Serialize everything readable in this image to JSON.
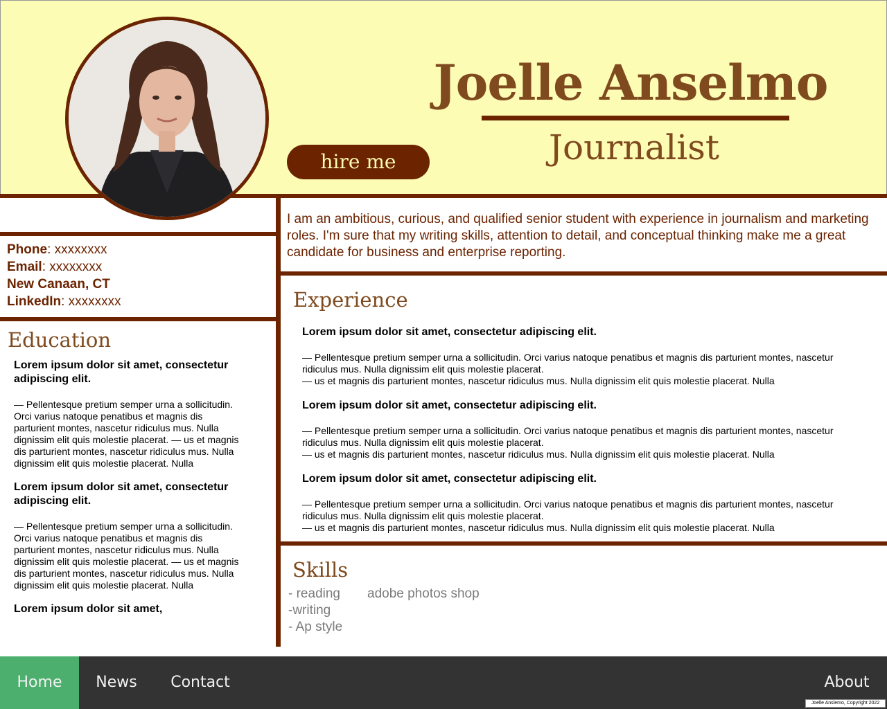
{
  "header": {
    "name": "Joelle Anselmo",
    "role": "Journalist",
    "hire_label": "hire me"
  },
  "contact": {
    "phone_label": "Phone",
    "phone_value": ": xxxxxxxx",
    "email_label": "Email",
    "email_value": ": xxxxxxxx",
    "location": "New Canaan, CT",
    "linkedin_label": "LinkedIn",
    "linkedin_value": ": xxxxxxxx"
  },
  "summary": "I am an ambitious, curious, and qualified senior student with experience in journalism and marketing roles. I'm sure that my writing skills, attention to detail, and conceptual thinking make me a great candidate for business and enterprise reporting.",
  "education": {
    "title": "Education",
    "entries": [
      {
        "title": "Lorem ipsum dolor sit amet, consectetur adipiscing elit.",
        "body": "— Pellentesque pretium semper urna a sollicitudin. Orci varius natoque penatibus et magnis dis parturient montes, nascetur ridiculus mus. Nulla dignissim elit quis molestie placerat. — us et magnis dis parturient montes, nascetur ridiculus mus. Nulla dignissim elit quis molestie placerat. Nulla"
      },
      {
        "title": "Lorem ipsum dolor sit amet, consectetur adipiscing elit.",
        "body": "— Pellentesque pretium semper urna a sollicitudin. Orci varius natoque penatibus et magnis dis parturient montes, nascetur ridiculus mus. Nulla dignissim elit quis molestie placerat. — us et magnis dis parturient montes, nascetur ridiculus mus. Nulla dignissim elit quis molestie placerat. Nulla"
      },
      {
        "title": "Lorem ipsum dolor sit amet,",
        "body": ""
      }
    ]
  },
  "experience": {
    "title": "Experience",
    "entries": [
      {
        "title": "Lorem ipsum dolor sit amet, consectetur adipiscing elit.",
        "body1": "— Pellentesque pretium semper urna a sollicitudin. Orci varius natoque penatibus et magnis dis parturient montes, nascetur ridiculus mus. Nulla dignissim elit quis molestie placerat.",
        "body2": "— us et magnis dis parturient montes, nascetur ridiculus mus. Nulla dignissim elit quis molestie placerat. Nulla"
      },
      {
        "title": "Lorem ipsum dolor sit amet, consectetur adipiscing elit.",
        "body1": "— Pellentesque pretium semper urna a sollicitudin. Orci varius natoque penatibus et magnis dis parturient montes, nascetur ridiculus mus. Nulla dignissim elit quis molestie placerat.",
        "body2": "— us et magnis dis parturient montes, nascetur ridiculus mus. Nulla dignissim elit quis molestie placerat. Nulla"
      },
      {
        "title": "Lorem ipsum dolor sit amet, consectetur adipiscing elit.",
        "body1": "— Pellentesque pretium semper urna a sollicitudin. Orci varius natoque penatibus et magnis dis parturient montes, nascetur ridiculus mus. Nulla dignissim elit quis molestie placerat.",
        "body2": "— us et magnis dis parturient montes, nascetur ridiculus mus. Nulla dignissim elit quis molestie placerat. Nulla"
      }
    ]
  },
  "skills": {
    "title": "Skills",
    "items": [
      "- reading",
      "-writing",
      "- Ap style"
    ],
    "extra": "adobe photos shop"
  },
  "nav": {
    "items": [
      "Home",
      "News",
      "Contact"
    ],
    "about": "About",
    "active": "Home"
  },
  "copyright": "Joelle Anslemo, Copyright 2022",
  "colors": {
    "header_bg": "#fdfcb4",
    "accent_brown": "#6b2300",
    "title_brown": "#7e4a1e",
    "nav_bg": "#333333",
    "nav_active": "#4caf6e"
  }
}
